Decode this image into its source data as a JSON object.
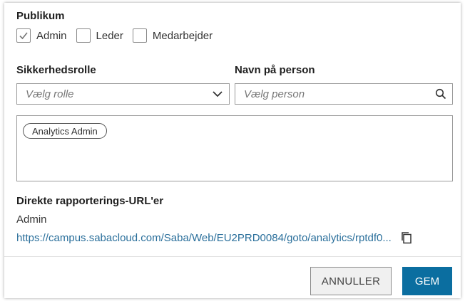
{
  "audience": {
    "heading": "Publikum",
    "options": [
      {
        "label": "Admin",
        "checked": true
      },
      {
        "label": "Leder",
        "checked": false
      },
      {
        "label": "Medarbejder",
        "checked": false
      }
    ]
  },
  "security_role": {
    "label": "Sikkerhedsrolle",
    "placeholder": "Vælg rolle",
    "icon": "chevron-down-icon"
  },
  "person_name": {
    "label": "Navn på person",
    "placeholder": "Vælg person",
    "icon": "search-icon"
  },
  "selected_roles": [
    "Analytics Admin"
  ],
  "direct_urls": {
    "heading": "Direkte rapporterings-URL'er",
    "audience_label": "Admin",
    "url": "https://campus.sabacloud.com/Saba/Web/EU2PRD0084/goto/analytics/rptdf0...",
    "icon": "copy-icon"
  },
  "footer": {
    "cancel_label": "ANNULLER",
    "save_label": "GEM",
    "save_color": "#0b6ea0"
  }
}
